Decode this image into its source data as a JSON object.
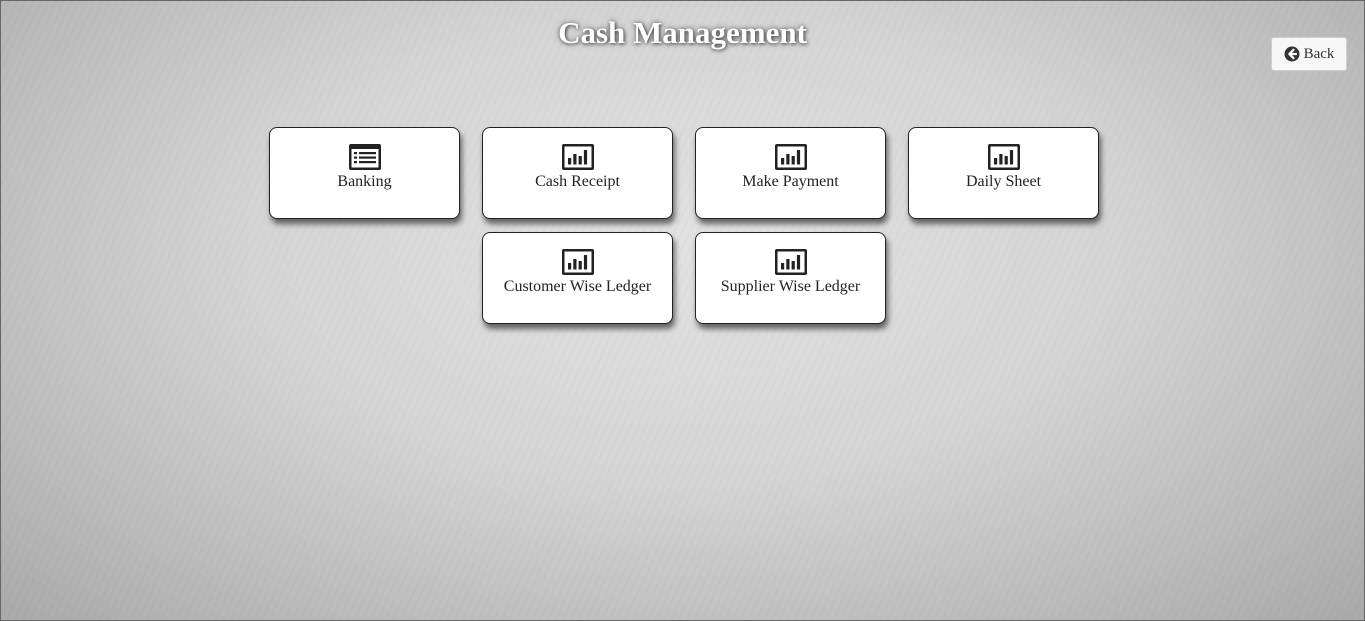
{
  "header": {
    "title": "Cash Management",
    "back_label": "Back"
  },
  "tiles": [
    {
      "label": "Banking",
      "icon": "list-card-icon"
    },
    {
      "label": "Cash Receipt",
      "icon": "bar-chart-icon"
    },
    {
      "label": "Make Payment",
      "icon": "bar-chart-icon"
    },
    {
      "label": "Daily Sheet",
      "icon": "bar-chart-icon"
    },
    {
      "label": "Customer Wise Ledger",
      "icon": "bar-chart-icon"
    },
    {
      "label": "Supplier Wise Ledger",
      "icon": "bar-chart-icon"
    }
  ],
  "colors": {
    "title": "#ffffff",
    "tile_background": "#ffffff",
    "tile_border": "#222222",
    "icon": "#222222"
  }
}
